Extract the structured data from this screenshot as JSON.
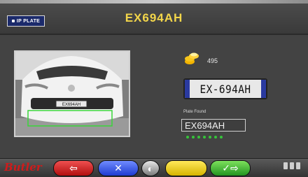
{
  "header": {
    "plate_tag": "IP PLATE",
    "title": "EX694AH"
  },
  "camera": {
    "plate_text": "EX694AH"
  },
  "credits": {
    "icon": "coins-icon",
    "value": "495"
  },
  "recognized": {
    "plate_text": "EX-694AH"
  },
  "plate_found": {
    "label": "Plate Found",
    "value": "EX694AH",
    "progress_dots": 7
  },
  "footer": {
    "logo": "Butler",
    "buttons": [
      "back-arrow-icon",
      "plate-cancel-icon",
      "wheel-icon",
      "blank",
      "ok-arrow-icon"
    ]
  },
  "colors": {
    "title": "#f3d64a",
    "dots": "#36c43a",
    "back": "#d52020",
    "plate": "#2f4bde",
    "yellow": "#f5d31c",
    "ok": "#3cbf2b"
  }
}
